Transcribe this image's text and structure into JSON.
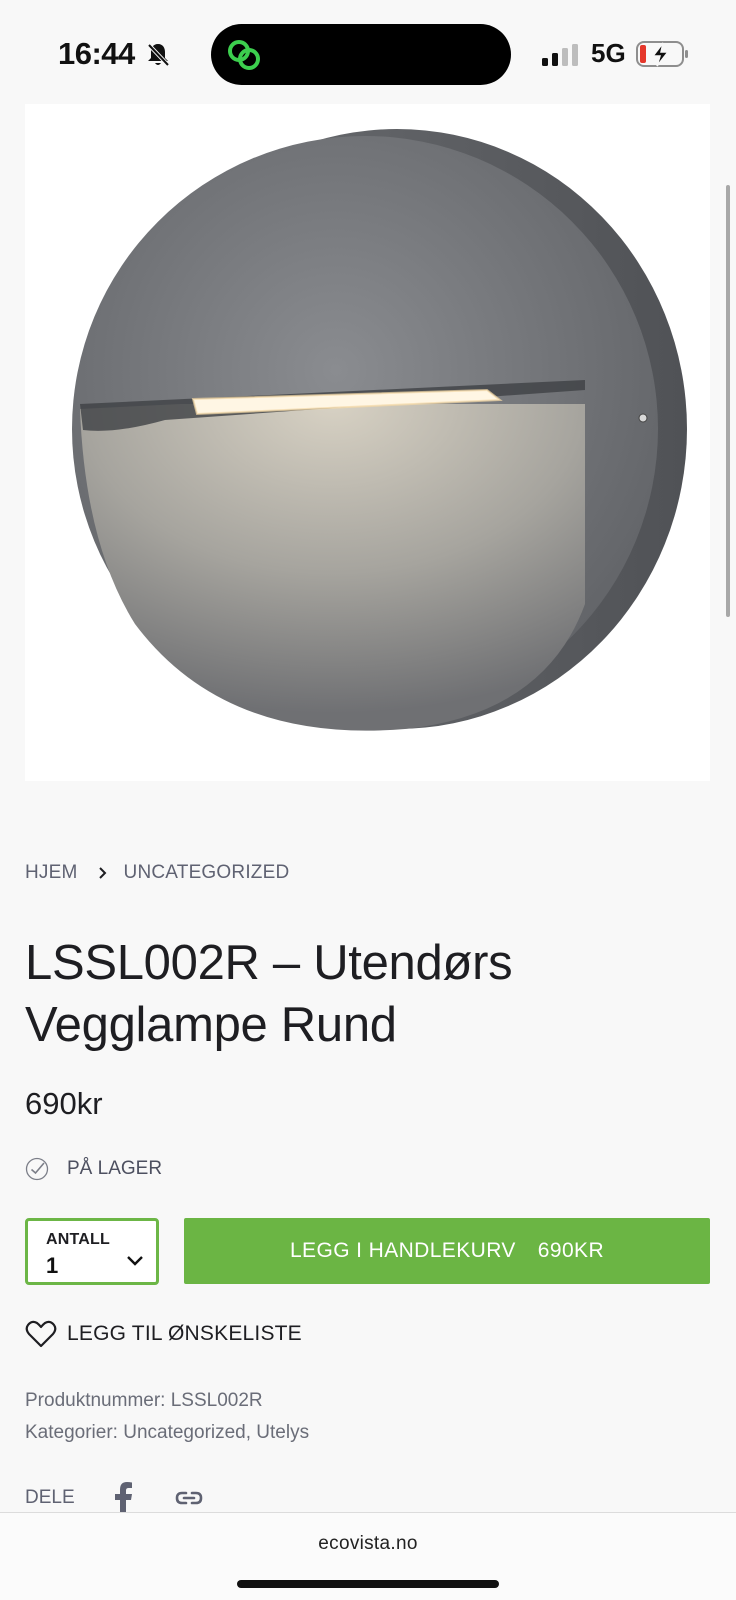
{
  "status_bar": {
    "time": "16:44",
    "network": "5G",
    "icons": [
      "bell-off-icon",
      "island-app-icon",
      "signal-icon",
      "battery-charging-icon"
    ],
    "colors": {
      "island_icon": "#3ccf4e",
      "battery_low": "#e5372b"
    }
  },
  "product": {
    "image_alt": "round-wall-lamp-image",
    "breadcrumb": [
      "HJEM",
      "UNCATEGORIZED"
    ],
    "title": "LSSL002R – Utendørs Vegglampe Rund",
    "price": "690kr",
    "stock": "PÅ LAGER",
    "quantity": {
      "label": "ANTALL",
      "value": "1"
    },
    "cart_button": {
      "label": "LEGG I HANDLEKURV",
      "price": "690KR"
    },
    "wishlist": "LEGG TIL ØNSKELISTE",
    "sku": {
      "label": "Produktnummer:",
      "value": "LSSL002R"
    },
    "categories": {
      "label": "Kategorier:",
      "value": "Uncategorized, Utelys"
    },
    "share_label": "DELE"
  },
  "browser": {
    "url": "ecovista.no"
  },
  "colors": {
    "accent": "#6bb544",
    "background": "#f8f8f8"
  }
}
